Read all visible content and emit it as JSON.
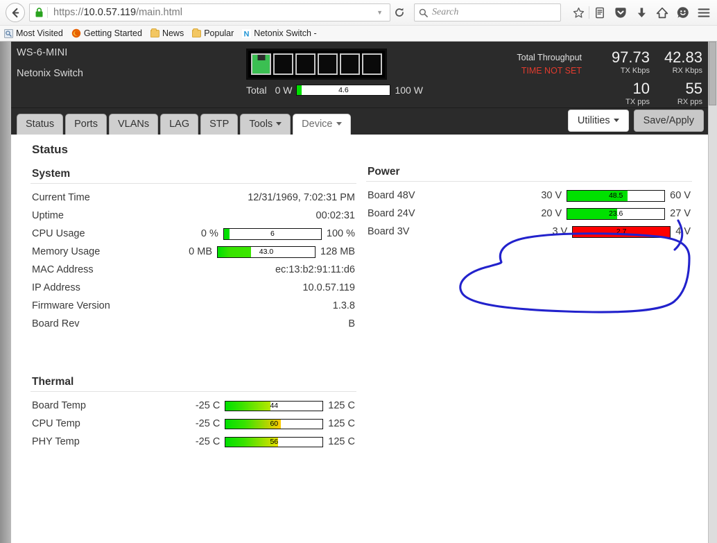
{
  "browser": {
    "url_scheme": "https://",
    "url_host": "10.0.57.119",
    "url_path": "/main.html",
    "search_placeholder": "Search",
    "back_icon": "back-arrow-icon",
    "lock_icon": "lock-icon",
    "reload_icon": "reload-icon",
    "dropdown_icon": "chevron-down-icon",
    "toolbar_icons": [
      "star-icon",
      "reader-list-icon",
      "pocket-icon",
      "download-icon",
      "home-icon",
      "smiley-icon",
      "hamburger-menu-icon"
    ],
    "bookmarks": [
      {
        "label": "Most Visited",
        "icon": "most-visited-icon"
      },
      {
        "label": "Getting Started",
        "icon": "firefox-icon"
      },
      {
        "label": "News",
        "icon": "folder-icon"
      },
      {
        "label": "Popular",
        "icon": "folder-icon"
      },
      {
        "label": "Netonix Switch -",
        "icon": "netonix-icon"
      }
    ]
  },
  "device_header": {
    "model": "WS-6-MINI",
    "name": "Netonix Switch",
    "ports": [
      {
        "index": 1,
        "state": "active"
      },
      {
        "index": 2,
        "state": "inactive"
      },
      {
        "index": 3,
        "state": "inactive"
      },
      {
        "index": 4,
        "state": "inactive"
      },
      {
        "index": 5,
        "state": "inactive"
      },
      {
        "index": 6,
        "state": "inactive"
      }
    ],
    "total_power": {
      "label": "Total",
      "min": "0 W",
      "max": "100 W",
      "value": "4.6",
      "percent": 4.6,
      "color": "#00e000"
    },
    "throughput": {
      "label": "Total Throughput",
      "time_status": "TIME NOT SET",
      "tx_kbps": "97.73",
      "tx_kbps_label": "TX Kbps",
      "rx_kbps": "42.83",
      "rx_kbps_label": "RX Kbps",
      "tx_pps": "10",
      "tx_pps_label": "TX pps",
      "rx_pps": "55",
      "rx_pps_label": "RX pps"
    }
  },
  "tabs": [
    {
      "label": "Status",
      "active": false,
      "dropdown": false
    },
    {
      "label": "Ports",
      "active": false,
      "dropdown": false
    },
    {
      "label": "VLANs",
      "active": false,
      "dropdown": false
    },
    {
      "label": "LAG",
      "active": false,
      "dropdown": false
    },
    {
      "label": "STP",
      "active": false,
      "dropdown": false
    },
    {
      "label": "Tools",
      "active": false,
      "dropdown": true
    },
    {
      "label": "Device",
      "active": true,
      "dropdown": true
    }
  ],
  "actions": {
    "utilities": "Utilities",
    "save_apply": "Save/Apply"
  },
  "status": {
    "page_title": "Status",
    "system": {
      "title": "System",
      "rows": [
        {
          "key": "Current Time",
          "value": "12/31/1969, 7:02:31 PM",
          "type": "text"
        },
        {
          "key": "Uptime",
          "value": "00:02:31",
          "type": "text"
        },
        {
          "key": "CPU Usage",
          "type": "gauge",
          "min": "0 %",
          "max": "100 %",
          "value": "6",
          "percent": 6,
          "color": "#00e000",
          "gradient": false
        },
        {
          "key": "Memory Usage",
          "type": "gauge",
          "min": "0 MB",
          "max": "128 MB",
          "value": "43.0",
          "percent": 34,
          "color": "#3ce600",
          "gradient": true
        },
        {
          "key": "MAC Address",
          "value": "ec:13:b2:91:11:d6",
          "type": "text"
        },
        {
          "key": "IP Address",
          "value": "10.0.57.119",
          "type": "text"
        },
        {
          "key": "Firmware Version",
          "value": "1.3.8",
          "type": "text"
        },
        {
          "key": "Board Rev",
          "value": "B",
          "type": "text"
        }
      ]
    },
    "thermal": {
      "title": "Thermal",
      "rows": [
        {
          "key": "Board Temp",
          "type": "gauge",
          "min": "-25 C",
          "max": "125 C",
          "value": "44",
          "percent": 46,
          "color": "#b6e800",
          "gradient": true
        },
        {
          "key": "CPU Temp",
          "type": "gauge",
          "min": "-25 C",
          "max": "125 C",
          "value": "60",
          "percent": 57,
          "color": "#ffcc00",
          "gradient": true
        },
        {
          "key": "PHY Temp",
          "type": "gauge",
          "min": "-25 C",
          "max": "125 C",
          "value": "56",
          "percent": 54,
          "color": "#e8e000",
          "gradient": true
        }
      ]
    },
    "power": {
      "title": "Power",
      "rows": [
        {
          "key": "Board 48V",
          "type": "gauge",
          "min": "30 V",
          "max": "60 V",
          "value": "48.5",
          "percent": 62,
          "color": "#00e000",
          "gradient": false
        },
        {
          "key": "Board 24V",
          "type": "gauge",
          "min": "20 V",
          "max": "27 V",
          "value": "23.6",
          "percent": 51,
          "color": "#00e000",
          "gradient": false
        },
        {
          "key": "Board 3V",
          "type": "gauge",
          "min": "3 V",
          "max": "4 V",
          "value": "2.7",
          "percent": 100,
          "color": "#ff0000",
          "gradient": false
        }
      ]
    }
  },
  "annotation": {
    "shape": "hand-drawn-ellipse",
    "color": "#2222cc",
    "target": "Board 3V power gauge"
  }
}
